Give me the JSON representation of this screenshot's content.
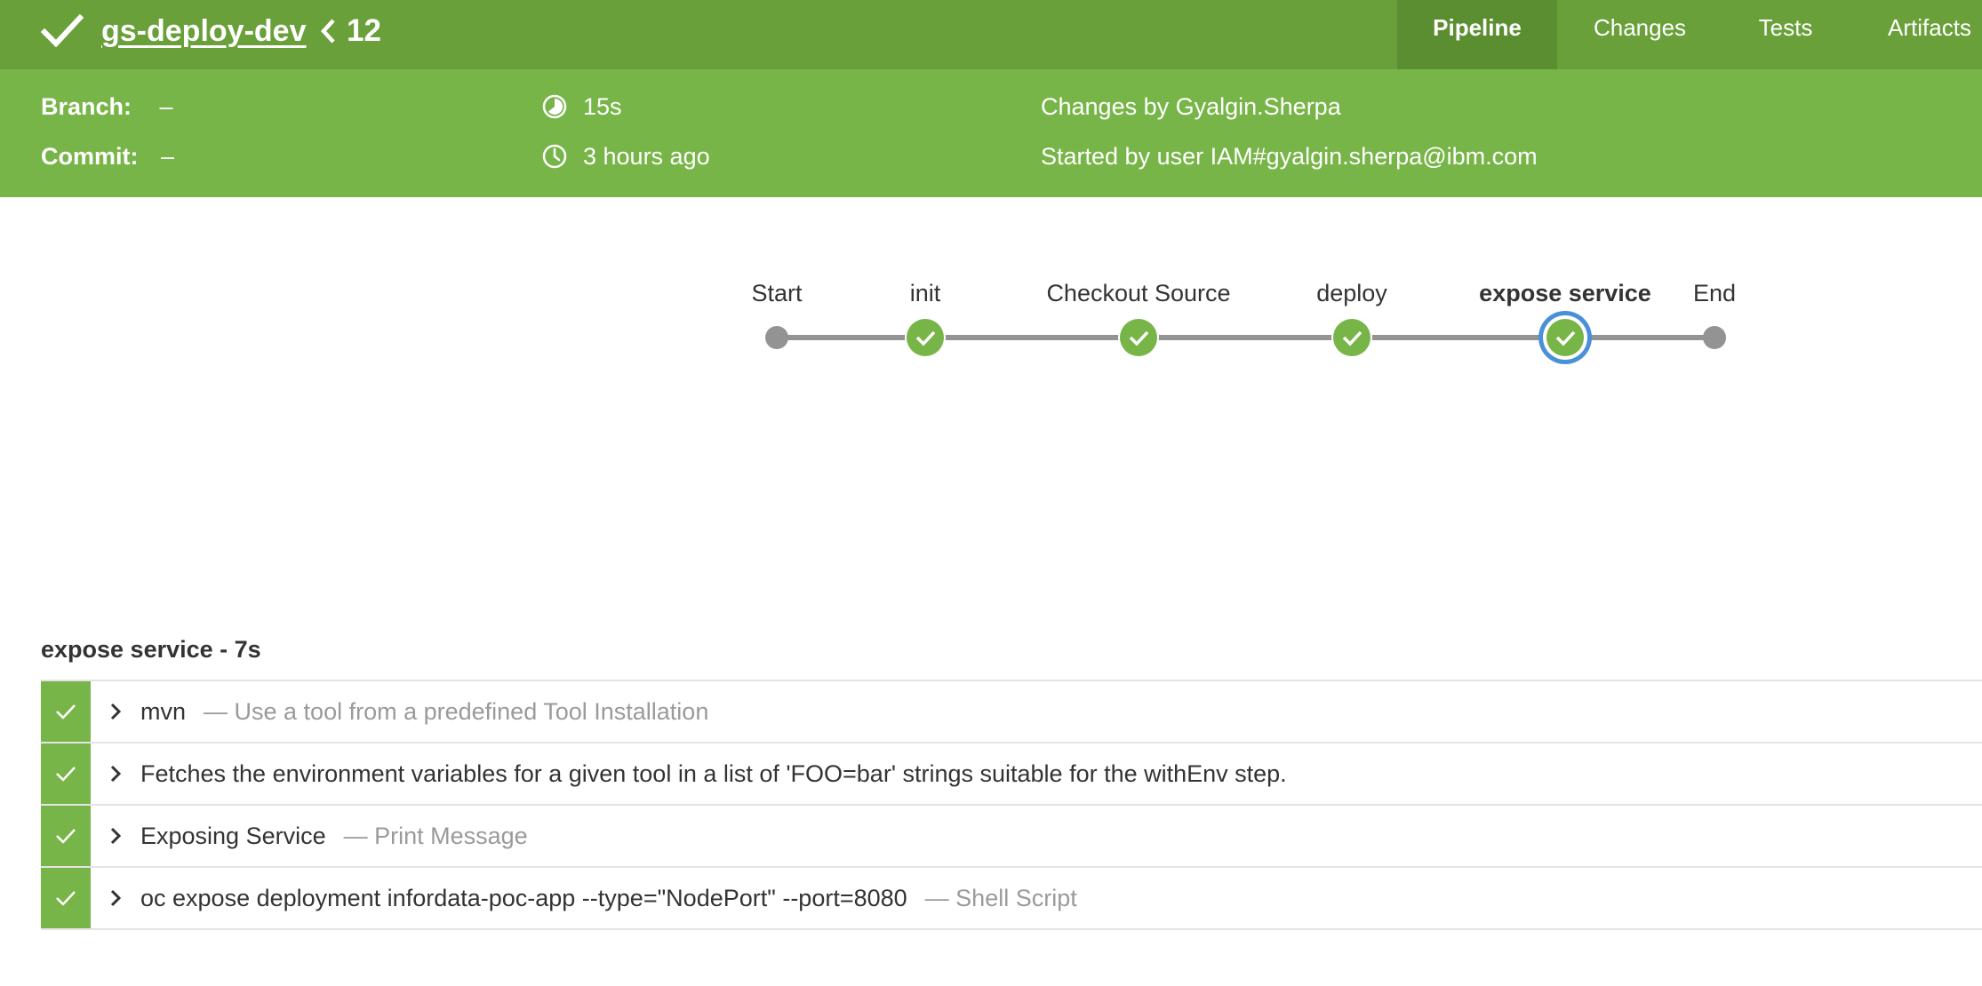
{
  "header": {
    "job_name": "gs-deploy-dev",
    "run_number": "12",
    "tabs": [
      {
        "label": "Pipeline",
        "active": true
      },
      {
        "label": "Changes",
        "active": false
      },
      {
        "label": "Tests",
        "active": false
      },
      {
        "label": "Artifacts",
        "active": false
      }
    ],
    "status_icon": "checkmark-icon",
    "accent_color": "#69a03a"
  },
  "summary": {
    "branch_label": "Branch:",
    "branch_value": "–",
    "commit_label": "Commit:",
    "commit_value": "–",
    "duration": "15s",
    "duration_icon": "duration-icon",
    "time_ago": "3 hours ago",
    "time_icon": "clock-icon",
    "changes_by": "Changes by Gyalgin.Sherpa",
    "started_by": "Started by user IAM#gyalgin.sherpa@ibm.com"
  },
  "pipeline": {
    "stages": [
      {
        "label": "Start",
        "kind": "terminal"
      },
      {
        "label": "init",
        "kind": "success"
      },
      {
        "label": "Checkout Source",
        "kind": "success"
      },
      {
        "label": "deploy",
        "kind": "success"
      },
      {
        "label": "expose service",
        "kind": "success",
        "selected": true
      },
      {
        "label": "End",
        "kind": "terminal"
      }
    ],
    "success_color": "#78b548",
    "selected_ring_color": "#4a90d9"
  },
  "steps_panel": {
    "title": "expose service - 7s",
    "steps": [
      {
        "name": "mvn",
        "description": "— Use a tool from a predefined Tool Installation"
      },
      {
        "name": "Fetches the environment variables for a given tool in a list of 'FOO=bar' strings suitable for the withEnv step.",
        "description": ""
      },
      {
        "name": "Exposing Service",
        "description": "— Print Message"
      },
      {
        "name": "oc expose deployment infordata-poc-app --type=\"NodePort\" --port=8080",
        "description": "— Shell Script"
      }
    ]
  }
}
